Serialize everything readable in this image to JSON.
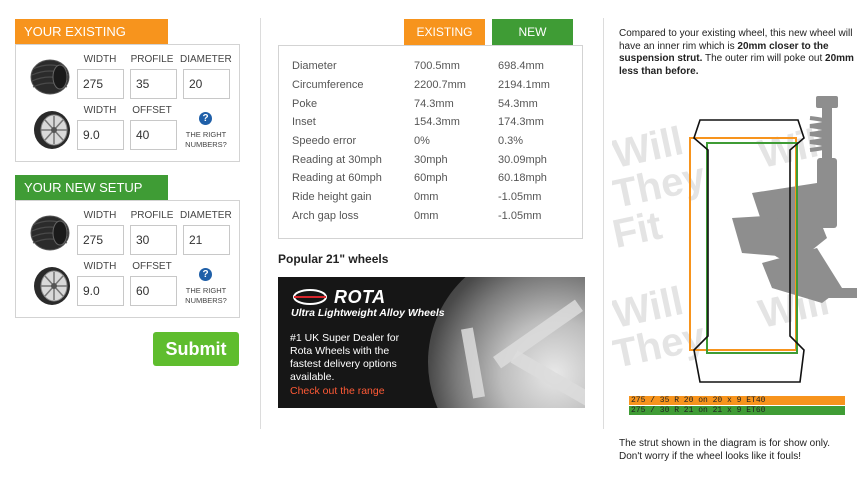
{
  "existing_setup": {
    "title": "YOUR EXISTING SETUP",
    "width_label": "WIDTH",
    "profile_label": "PROFILE",
    "diameter_label": "DIAMETER",
    "width": "275",
    "profile": "35",
    "diameter": "20",
    "rim_width_label": "WIDTH",
    "offset_label": "OFFSET",
    "rim_width": "9.0",
    "offset": "40",
    "help_text": "THE RIGHT NUMBERS?"
  },
  "new_setup": {
    "title": "YOUR NEW SETUP",
    "width_label": "WIDTH",
    "profile_label": "PROFILE",
    "diameter_label": "DIAMETER",
    "width": "275",
    "profile": "30",
    "diameter": "21",
    "rim_width_label": "WIDTH",
    "offset_label": "OFFSET",
    "rim_width": "9.0",
    "offset": "60",
    "help_text": "THE RIGHT NUMBERS?"
  },
  "submit_label": "Submit",
  "comparison": {
    "existing_tab": "EXISTING",
    "new_tab": "NEW",
    "rows": [
      {
        "label": "Diameter",
        "existing": "700.5mm",
        "new": "698.4mm"
      },
      {
        "label": "Circumference",
        "existing": "2200.7mm",
        "new": "2194.1mm"
      },
      {
        "label": "Poke",
        "existing": "74.3mm",
        "new": "54.3mm"
      },
      {
        "label": "Inset",
        "existing": "154.3mm",
        "new": "174.3mm"
      },
      {
        "label": "Speedo error",
        "existing": "0%",
        "new": "0.3%"
      },
      {
        "label": "Reading at 30mph",
        "existing": "30mph",
        "new": "30.09mph"
      },
      {
        "label": "Reading at 60mph",
        "existing": "60mph",
        "new": "60.18mph"
      },
      {
        "label": "Ride height gain",
        "existing": "0mm",
        "new": "-1.05mm"
      },
      {
        "label": "Arch gap loss",
        "existing": "0mm",
        "new": "-1.05mm"
      }
    ]
  },
  "popular": {
    "title": "Popular 21\" wheels"
  },
  "ad": {
    "brand": "ROTA",
    "tagline": "Ultra Lightweight Alloy Wheels",
    "body": "#1 UK Super Dealer for Rota Wheels with the fastest delivery options available.",
    "cta": "Check out the range"
  },
  "diagram": {
    "intro_1": "Compared to your existing wheel, this new wheel will have an inner rim which is ",
    "intro_bold_1": "20mm closer to the suspension strut.",
    "intro_2": " The outer rim will poke out ",
    "intro_bold_2": "20mm less than before.",
    "watermark": "Will They Fit.com",
    "legend_existing": "275 / 35 R 20 on 20 x 9 ET40",
    "legend_new": "275 / 30 R 21 on 21 x 9 ET60",
    "existing_color": "#f7941d",
    "new_color": "#3f9c35",
    "footnote": "The strut shown in the diagram is for show only. Don't worry if the wheel looks like it fouls!"
  },
  "colors": {
    "orange": "#f7941d",
    "green": "#3f9c35",
    "submit": "#5fbd2e",
    "help": "#1f5fa8"
  }
}
